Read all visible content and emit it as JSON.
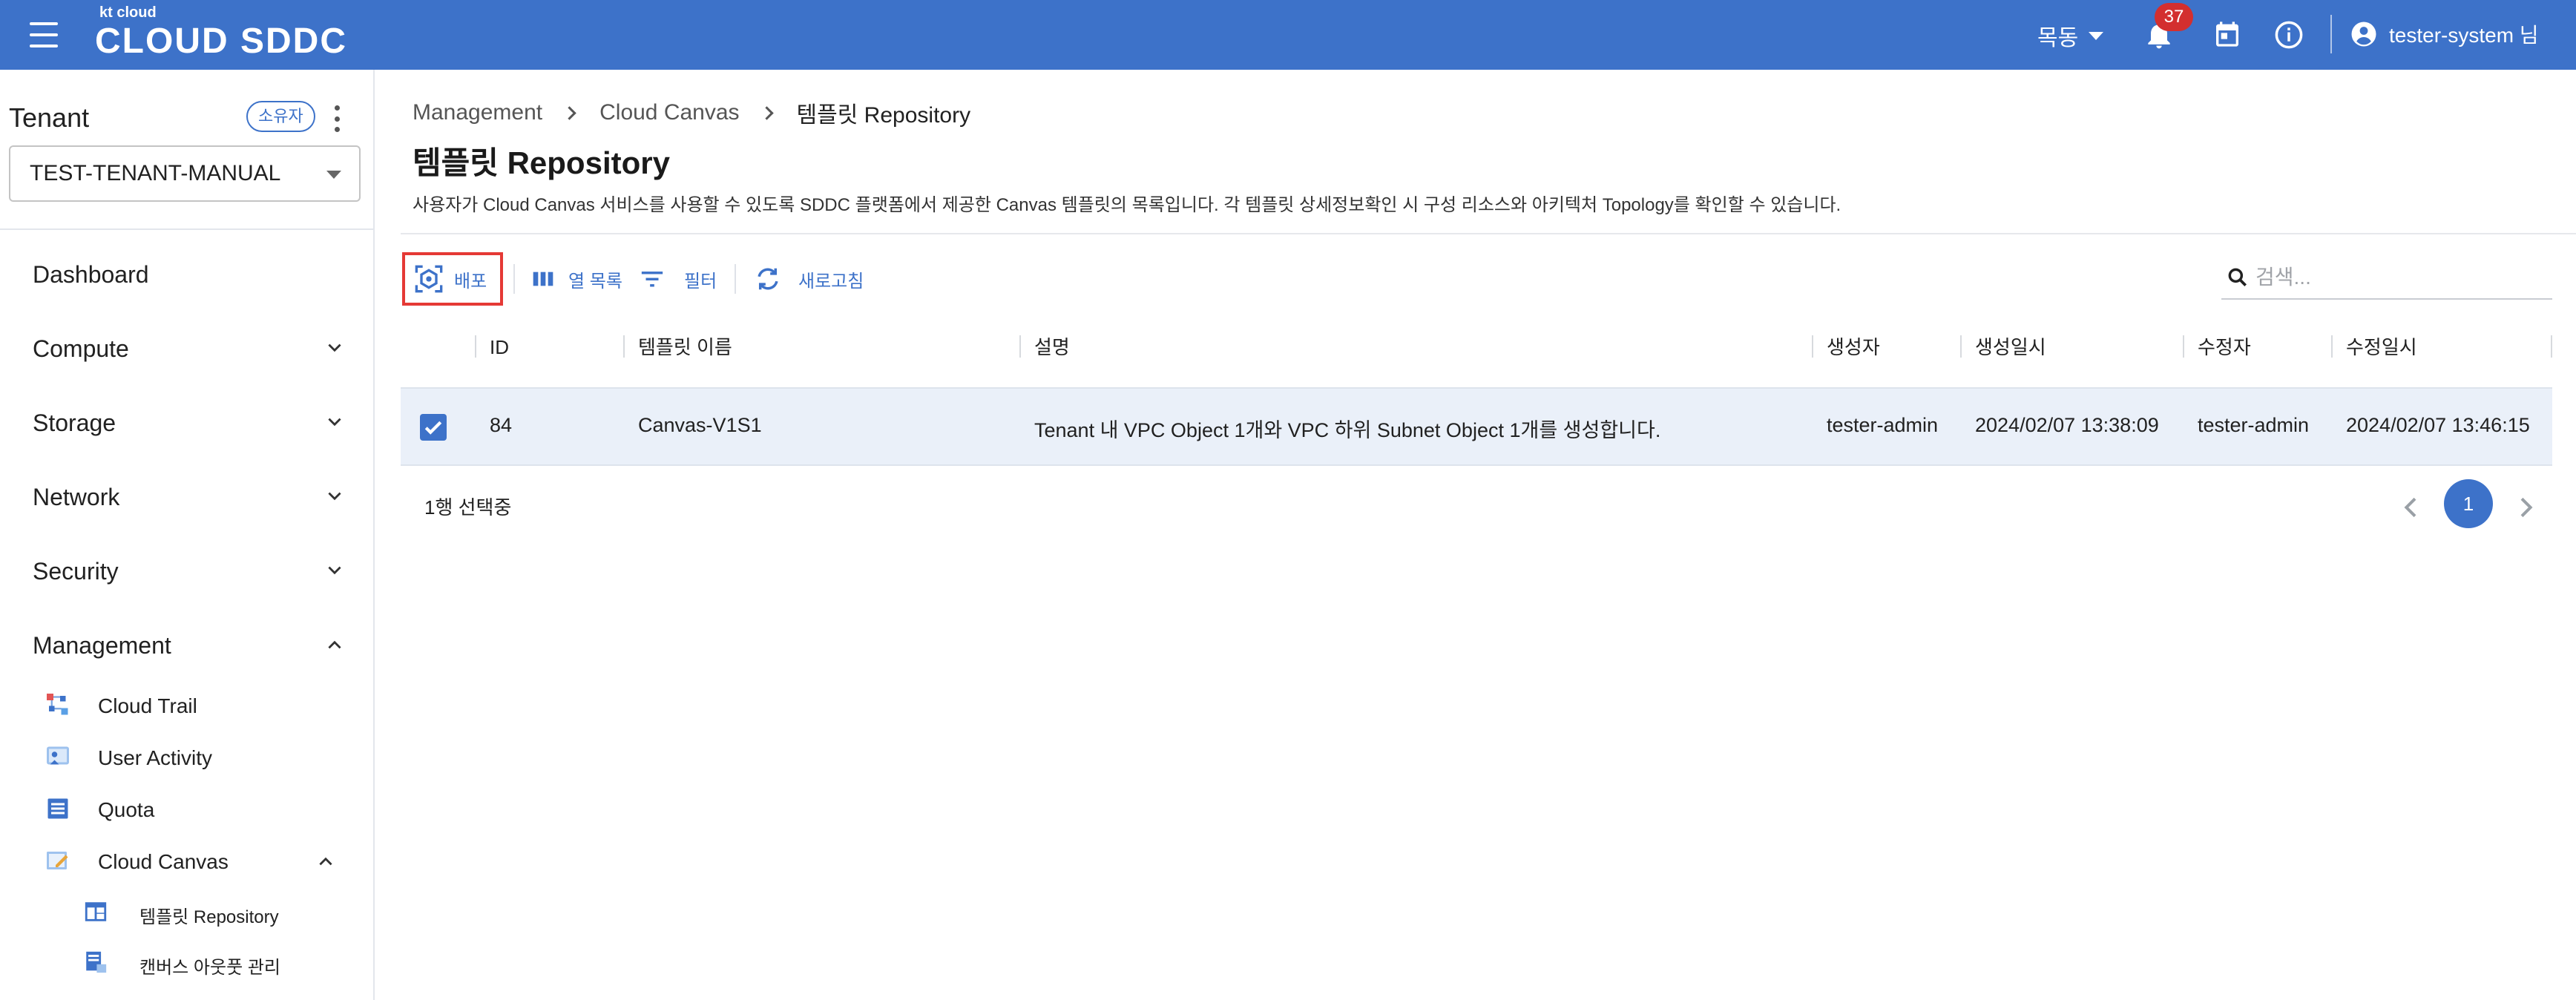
{
  "header": {
    "logo_small": "kt cloud",
    "logo_big": "CLOUD SDDC",
    "language": "목동",
    "notification_count": "37",
    "user_name": "tester-system 님",
    "bar_color": "#3d72c9"
  },
  "sidebar": {
    "tenant_title": "Tenant",
    "owner_chip": "소유자",
    "tenant_selected": "TEST-TENANT-MANUAL",
    "nav": [
      {
        "label": "Dashboard"
      },
      {
        "label": "Compute"
      },
      {
        "label": "Storage"
      },
      {
        "label": "Network"
      },
      {
        "label": "Security"
      },
      {
        "label": "Management"
      }
    ],
    "management_items": [
      {
        "label": "Cloud Trail",
        "icon": "cloud-trail-icon"
      },
      {
        "label": "User Activity",
        "icon": "user-activity-icon"
      },
      {
        "label": "Quota",
        "icon": "quota-icon"
      },
      {
        "label": "Cloud Canvas",
        "icon": "cloud-canvas-icon"
      }
    ],
    "canvas_items": [
      {
        "label": "템플릿 Repository",
        "icon": "template-repository-icon"
      },
      {
        "label": "캔버스 아웃풋 관리",
        "icon": "canvas-output-icon"
      }
    ]
  },
  "breadcrumb": [
    "Management",
    "Cloud Canvas",
    "템플릿 Repository"
  ],
  "page": {
    "title": "템플릿 Repository",
    "description": "사용자가 Cloud Canvas 서비스를 사용할 수 있도록 SDDC 플랫폼에서 제공한 Canvas 템플릿의 목록입니다. 각 템플릿 상세정보확인 시 구성 리소스와 아키텍처 Topology를 확인할 수 있습니다."
  },
  "toolbar": {
    "deploy": "배포",
    "columns": "열 목록",
    "filter": "필터",
    "refresh": "새로고침",
    "search_placeholder": "검색..."
  },
  "table": {
    "headers": [
      "ID",
      "템플릿 이름",
      "설명",
      "생성자",
      "생성일시",
      "수정자",
      "수정일시"
    ],
    "rows": [
      {
        "selected": true,
        "id": "84",
        "name": "Canvas-V1S1",
        "description": "Tenant 내 VPC Object 1개와 VPC 하위 Subnet Object 1개를 생성합니다.",
        "created_by": "tester-admin",
        "created_at": "2024/02/07 13:38:09",
        "modified_by": "tester-admin",
        "modified_at": "2024/02/07 13:46:15"
      }
    ],
    "selected_count": "1행 선택중"
  },
  "pagination": {
    "current_page": "1"
  }
}
